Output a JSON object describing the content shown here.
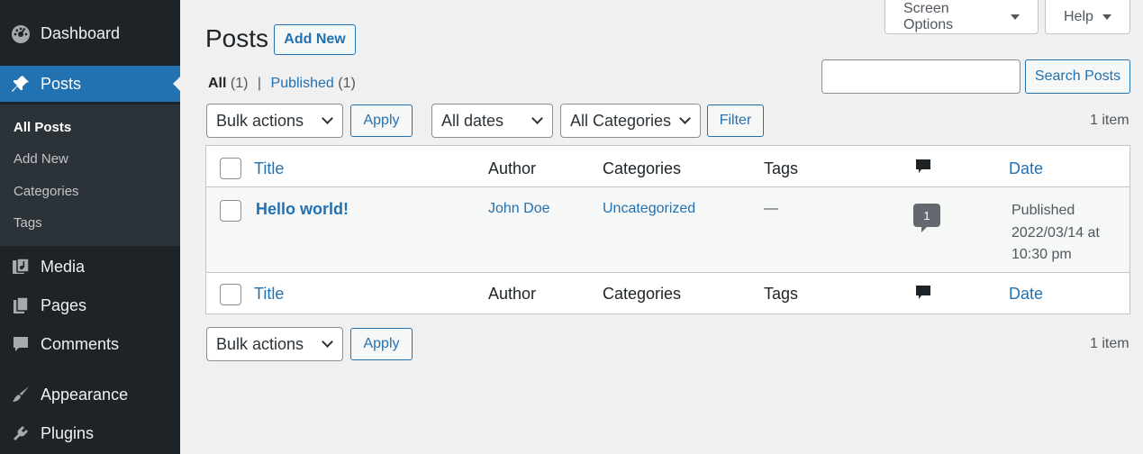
{
  "sidebar": {
    "items": [
      {
        "label": "Dashboard",
        "icon": "dashboard-icon"
      },
      {
        "label": "Posts",
        "icon": "pushpin-icon"
      },
      {
        "label": "Media",
        "icon": "media-icon"
      },
      {
        "label": "Pages",
        "icon": "pages-icon"
      },
      {
        "label": "Comments",
        "icon": "comment-icon"
      },
      {
        "label": "Appearance",
        "icon": "brush-icon"
      },
      {
        "label": "Plugins",
        "icon": "plug-icon"
      }
    ],
    "submenu": [
      "All Posts",
      "Add New",
      "Categories",
      "Tags"
    ]
  },
  "header": {
    "screen_options": "Screen Options",
    "help": "Help",
    "title": "Posts",
    "add_new": "Add New"
  },
  "filters": {
    "all_label": "All",
    "all_count": "(1)",
    "separator": "|",
    "published_label": "Published",
    "published_count": "(1)",
    "search_placeholder": "",
    "search_button": "Search Posts",
    "bulk_actions": "Bulk actions",
    "apply": "Apply",
    "all_dates": "All dates",
    "all_categories": "All Categories",
    "filter": "Filter",
    "item_count": "1 item"
  },
  "table": {
    "columns": {
      "title": "Title",
      "author": "Author",
      "categories": "Categories",
      "tags": "Tags",
      "comments_icon": "comment-bubble-icon",
      "date": "Date"
    },
    "rows": [
      {
        "title": "Hello world!",
        "author": "John Doe",
        "categories": "Uncategorized",
        "tags": "—",
        "comments": "1",
        "date_line1": "Published",
        "date_line2": "2022/03/14 at",
        "date_line3": "10:30 pm"
      }
    ]
  },
  "colors": {
    "sidebar_bg": "#1d2327",
    "accent": "#2271b1",
    "background": "#f0f0f1"
  }
}
